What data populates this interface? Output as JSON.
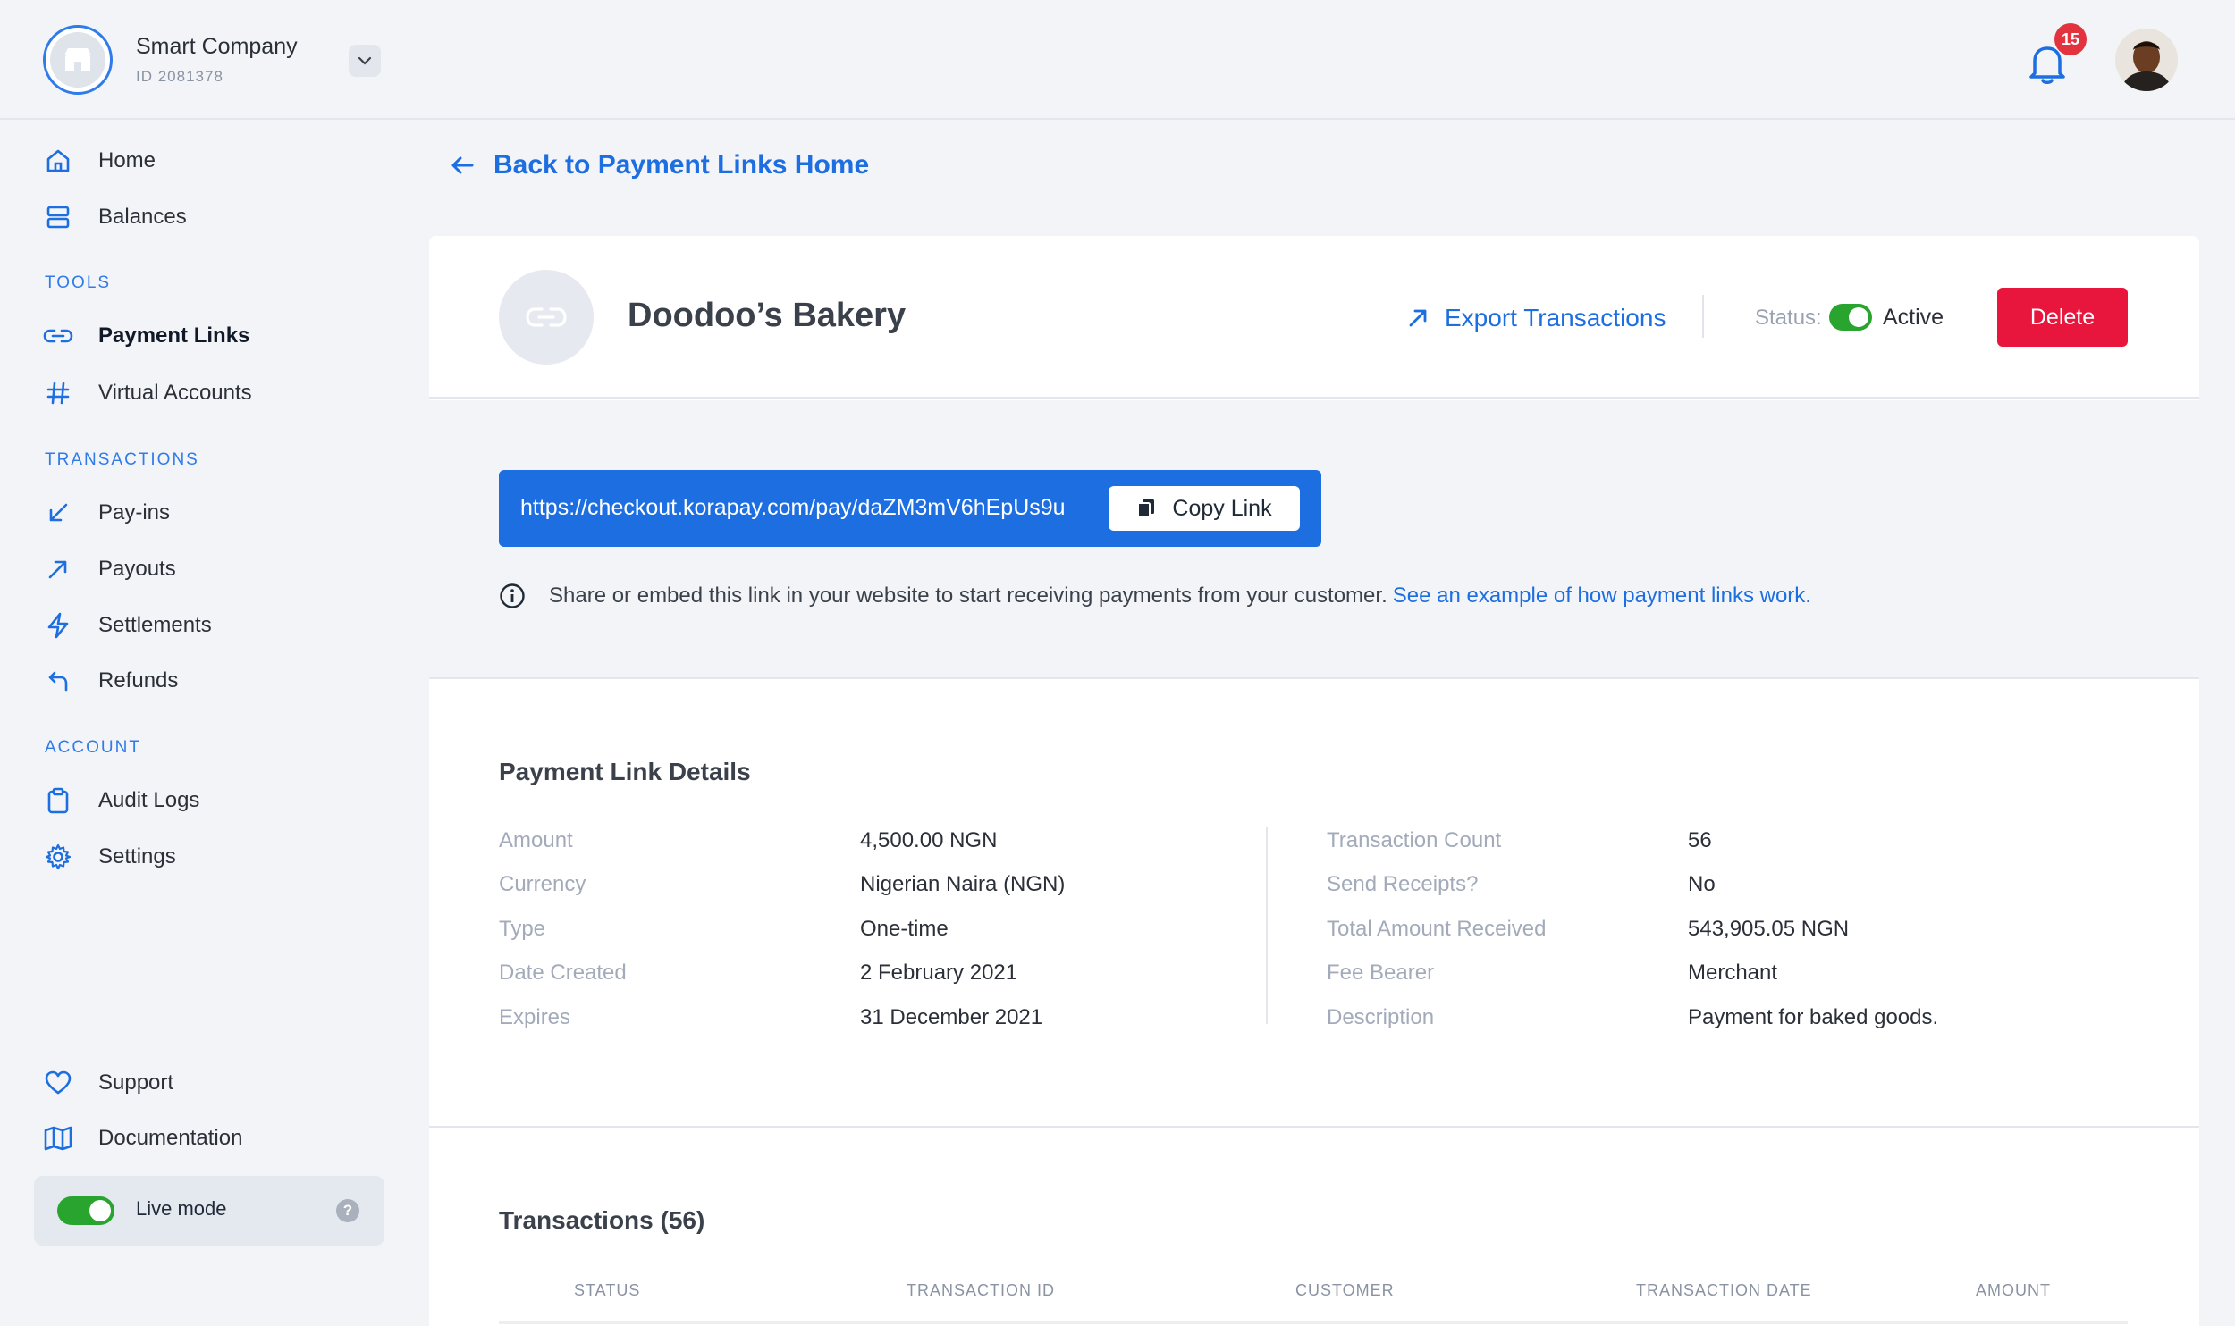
{
  "company": {
    "name": "Smart Company",
    "id": "ID 2081378"
  },
  "notifications": {
    "count": "15"
  },
  "sidebar": {
    "main": [
      {
        "label": "Home",
        "icon": "home-icon"
      },
      {
        "label": "Balances",
        "icon": "balances-icon"
      }
    ],
    "tools_label": "TOOLS",
    "tools": [
      {
        "label": "Payment Links",
        "icon": "link-icon",
        "active": true
      },
      {
        "label": "Virtual Accounts",
        "icon": "hash-icon"
      }
    ],
    "transactions_label": "TRANSACTIONS",
    "transactions": [
      {
        "label": "Pay-ins",
        "icon": "arrow-down-left-icon"
      },
      {
        "label": "Payouts",
        "icon": "arrow-up-right-icon"
      },
      {
        "label": "Settlements",
        "icon": "lightning-icon"
      },
      {
        "label": "Refunds",
        "icon": "return-icon"
      }
    ],
    "account_label": "ACCOUNT",
    "account": [
      {
        "label": "Audit Logs",
        "icon": "clipboard-icon"
      },
      {
        "label": "Settings",
        "icon": "gear-icon"
      }
    ],
    "footer": [
      {
        "label": "Support",
        "icon": "heart-icon"
      },
      {
        "label": "Documentation",
        "icon": "map-icon"
      }
    ],
    "live_mode": {
      "label": "Live mode",
      "enabled": true,
      "help": "?"
    }
  },
  "back_link": "Back to Payment Links Home",
  "payment_link": {
    "title": "Doodoo’s Bakery",
    "export_label": "Export Transactions",
    "status_label": "Status:",
    "status_value": "Active",
    "delete_label": "Delete",
    "url": "https://checkout.korapay.com/pay/daZM3mV6hEpUs9u",
    "copy_label": "Copy Link",
    "info_text": "Share or embed this link in your website to start receiving payments from your customer.",
    "info_link": "See an example of how payment links work."
  },
  "details": {
    "title": "Payment Link Details",
    "left": [
      {
        "label": "Amount",
        "value": "4,500.00 NGN"
      },
      {
        "label": "Currency",
        "value": "Nigerian Naira (NGN)"
      },
      {
        "label": "Type",
        "value": "One-time"
      },
      {
        "label": "Date Created",
        "value": "2 February 2021"
      },
      {
        "label": "Expires",
        "value": "31 December 2021"
      }
    ],
    "right": [
      {
        "label": "Transaction Count",
        "value": "56"
      },
      {
        "label": "Send Receipts?",
        "value": "No"
      },
      {
        "label": "Total Amount Received",
        "value": "543,905.05 NGN"
      },
      {
        "label": "Fee Bearer",
        "value": "Merchant"
      },
      {
        "label": "Description",
        "value": "Payment for baked goods."
      }
    ]
  },
  "transactions": {
    "title": "Transactions (56)",
    "columns": [
      "STATUS",
      "TRANSACTION ID",
      "CUSTOMER",
      "TRANSACTION DATE",
      "AMOUNT"
    ]
  },
  "colors": {
    "accent": "#1d6ee0",
    "danger": "#e8163c",
    "success": "#29a52f"
  }
}
